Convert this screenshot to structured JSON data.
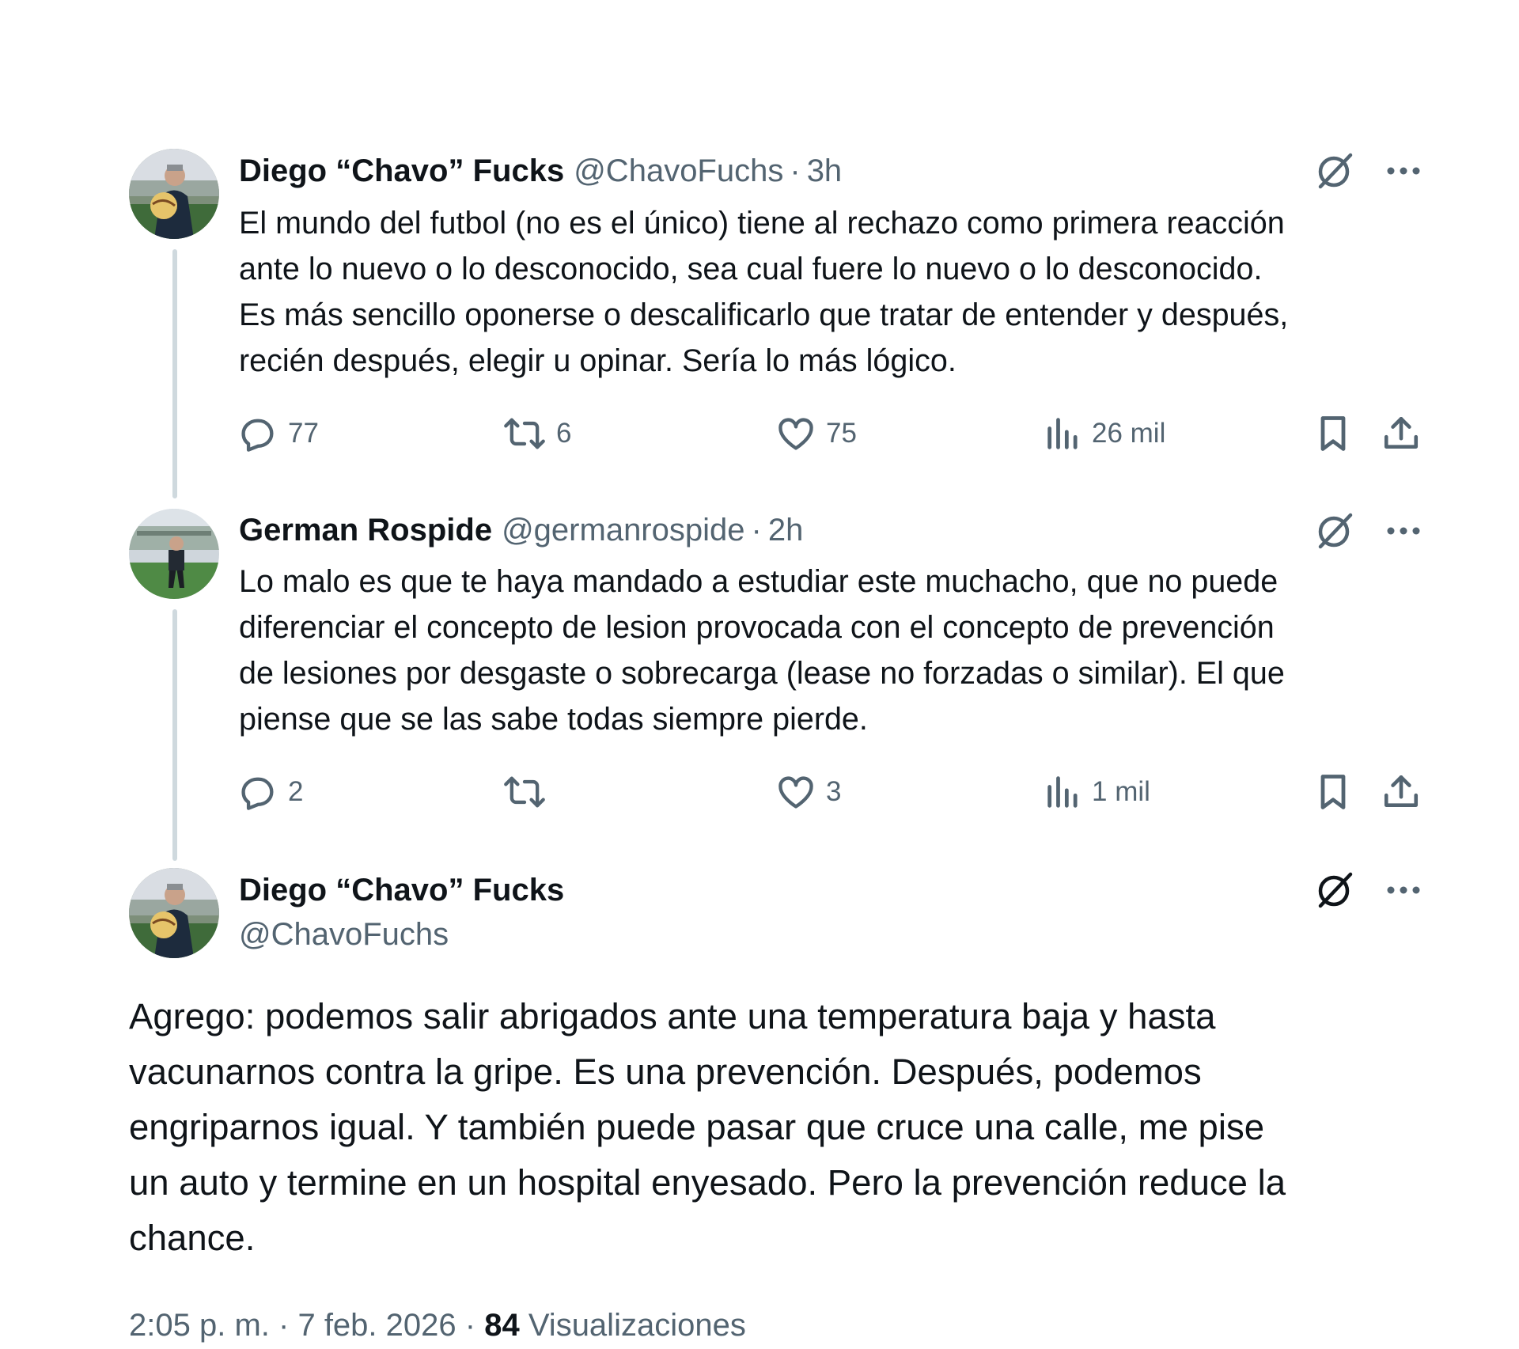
{
  "colors": {
    "text_primary": "#0f1419",
    "text_secondary": "#536471",
    "thread_line": "#cfd9de"
  },
  "icons": {
    "grok": "grok-icon",
    "more": "more-icon",
    "reply": "reply-icon",
    "retweet": "retweet-icon",
    "like": "heart-icon",
    "views": "views-icon",
    "bookmark": "bookmark-icon",
    "share": "share-icon"
  },
  "tweets": [
    {
      "author": "Diego “Chavo” Fucks",
      "handle": "@ChavoFuchs",
      "separator": "·",
      "time": "3h",
      "text": "El mundo del futbol (no es el único) tiene al rechazo como primera reacción\nante lo nuevo o lo desconocido, sea cual fuere lo nuevo o lo desconocido.\nEs más sencillo oponerse o descalificarlo que tratar de entender y después,\nrecién después, elegir u opinar. Sería lo más lógico.",
      "replies": "77",
      "retweets": "6",
      "likes": "75",
      "views": "26 mil"
    },
    {
      "author": "German Rospide",
      "handle": "@germanrospide",
      "separator": "·",
      "time": "2h",
      "text": "Lo malo es que te haya mandado a estudiar este muchacho, que no puede\ndiferenciar el concepto de lesion provocada con el concepto de prevención\nde lesiones por desgaste o sobrecarga (lease no forzadas o similar). El que\npiense que se las sabe todas siempre pierde.",
      "replies": "2",
      "retweets": "",
      "likes": "3",
      "views": "1 mil"
    }
  ],
  "main_tweet": {
    "author": "Diego “Chavo” Fucks",
    "handle": "@ChavoFuchs",
    "text": "Agrego: podemos salir abrigados ante una temperatura baja y hasta\nvacunarnos contra la gripe. Es una prevención. Después, podemos\nengriparnos igual. Y también puede pasar que cruce una calle, me pise\nun auto y termine en un hospital enyesado. Pero la prevención reduce la\nchance.",
    "time": "2:05 p. m.",
    "separator": "·",
    "date": "7 feb. 2026",
    "views_count": "84",
    "views_label": "Visualizaciones"
  }
}
